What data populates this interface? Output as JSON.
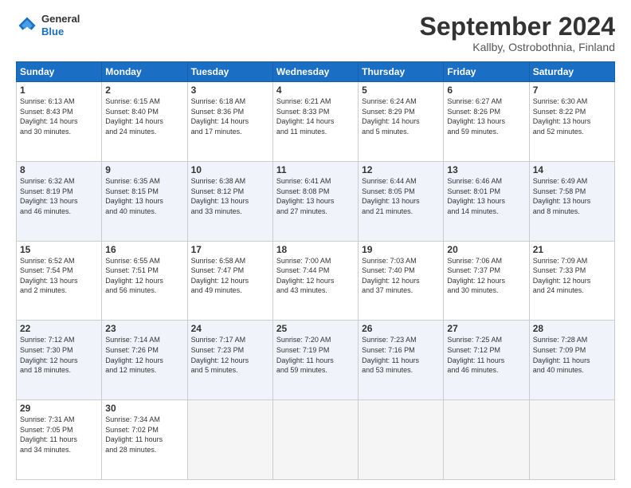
{
  "header": {
    "logo": {
      "general": "General",
      "blue": "Blue"
    },
    "title": "September 2024",
    "subtitle": "Kallby, Ostrobothnia, Finland"
  },
  "calendar": {
    "weekdays": [
      "Sunday",
      "Monday",
      "Tuesday",
      "Wednesday",
      "Thursday",
      "Friday",
      "Saturday"
    ],
    "weeks": [
      [
        null,
        {
          "day": "2",
          "sunrise": "6:15 AM",
          "sunset": "8:40 PM",
          "daylight": "14 hours and 24 minutes."
        },
        {
          "day": "3",
          "sunrise": "6:18 AM",
          "sunset": "8:36 PM",
          "daylight": "14 hours and 17 minutes."
        },
        {
          "day": "4",
          "sunrise": "6:21 AM",
          "sunset": "8:33 PM",
          "daylight": "14 hours and 11 minutes."
        },
        {
          "day": "5",
          "sunrise": "6:24 AM",
          "sunset": "8:29 PM",
          "daylight": "14 hours and 5 minutes."
        },
        {
          "day": "6",
          "sunrise": "6:27 AM",
          "sunset": "8:26 PM",
          "daylight": "13 hours and 59 minutes."
        },
        {
          "day": "7",
          "sunrise": "6:30 AM",
          "sunset": "8:22 PM",
          "daylight": "13 hours and 52 minutes."
        }
      ],
      [
        {
          "day": "1",
          "sunrise": "6:13 AM",
          "sunset": "8:43 PM",
          "daylight": "14 hours and 30 minutes."
        },
        {
          "day": "9",
          "sunrise": "6:35 AM",
          "sunset": "8:15 PM",
          "daylight": "13 hours and 40 minutes."
        },
        {
          "day": "10",
          "sunrise": "6:38 AM",
          "sunset": "8:12 PM",
          "daylight": "13 hours and 33 minutes."
        },
        {
          "day": "11",
          "sunrise": "6:41 AM",
          "sunset": "8:08 PM",
          "daylight": "13 hours and 27 minutes."
        },
        {
          "day": "12",
          "sunrise": "6:44 AM",
          "sunset": "8:05 PM",
          "daylight": "13 hours and 21 minutes."
        },
        {
          "day": "13",
          "sunrise": "6:46 AM",
          "sunset": "8:01 PM",
          "daylight": "13 hours and 14 minutes."
        },
        {
          "day": "14",
          "sunrise": "6:49 AM",
          "sunset": "7:58 PM",
          "daylight": "13 hours and 8 minutes."
        }
      ],
      [
        {
          "day": "8",
          "sunrise": "6:32 AM",
          "sunset": "8:19 PM",
          "daylight": "13 hours and 46 minutes."
        },
        {
          "day": "16",
          "sunrise": "6:55 AM",
          "sunset": "7:51 PM",
          "daylight": "12 hours and 56 minutes."
        },
        {
          "day": "17",
          "sunrise": "6:58 AM",
          "sunset": "7:47 PM",
          "daylight": "12 hours and 49 minutes."
        },
        {
          "day": "18",
          "sunrise": "7:00 AM",
          "sunset": "7:44 PM",
          "daylight": "12 hours and 43 minutes."
        },
        {
          "day": "19",
          "sunrise": "7:03 AM",
          "sunset": "7:40 PM",
          "daylight": "12 hours and 37 minutes."
        },
        {
          "day": "20",
          "sunrise": "7:06 AM",
          "sunset": "7:37 PM",
          "daylight": "12 hours and 30 minutes."
        },
        {
          "day": "21",
          "sunrise": "7:09 AM",
          "sunset": "7:33 PM",
          "daylight": "12 hours and 24 minutes."
        }
      ],
      [
        {
          "day": "15",
          "sunrise": "6:52 AM",
          "sunset": "7:54 PM",
          "daylight": "13 hours and 2 minutes."
        },
        {
          "day": "23",
          "sunrise": "7:14 AM",
          "sunset": "7:26 PM",
          "daylight": "12 hours and 12 minutes."
        },
        {
          "day": "24",
          "sunrise": "7:17 AM",
          "sunset": "7:23 PM",
          "daylight": "12 hours and 5 minutes."
        },
        {
          "day": "25",
          "sunrise": "7:20 AM",
          "sunset": "7:19 PM",
          "daylight": "11 hours and 59 minutes."
        },
        {
          "day": "26",
          "sunrise": "7:23 AM",
          "sunset": "7:16 PM",
          "daylight": "11 hours and 53 minutes."
        },
        {
          "day": "27",
          "sunrise": "7:25 AM",
          "sunset": "7:12 PM",
          "daylight": "11 hours and 46 minutes."
        },
        {
          "day": "28",
          "sunrise": "7:28 AM",
          "sunset": "7:09 PM",
          "daylight": "11 hours and 40 minutes."
        }
      ],
      [
        {
          "day": "22",
          "sunrise": "7:12 AM",
          "sunset": "7:30 PM",
          "daylight": "12 hours and 18 minutes."
        },
        {
          "day": "30",
          "sunrise": "7:34 AM",
          "sunset": "7:02 PM",
          "daylight": "11 hours and 28 minutes."
        },
        null,
        null,
        null,
        null,
        null
      ],
      [
        {
          "day": "29",
          "sunrise": "7:31 AM",
          "sunset": "7:05 PM",
          "daylight": "11 hours and 34 minutes."
        },
        null,
        null,
        null,
        null,
        null,
        null
      ]
    ]
  }
}
